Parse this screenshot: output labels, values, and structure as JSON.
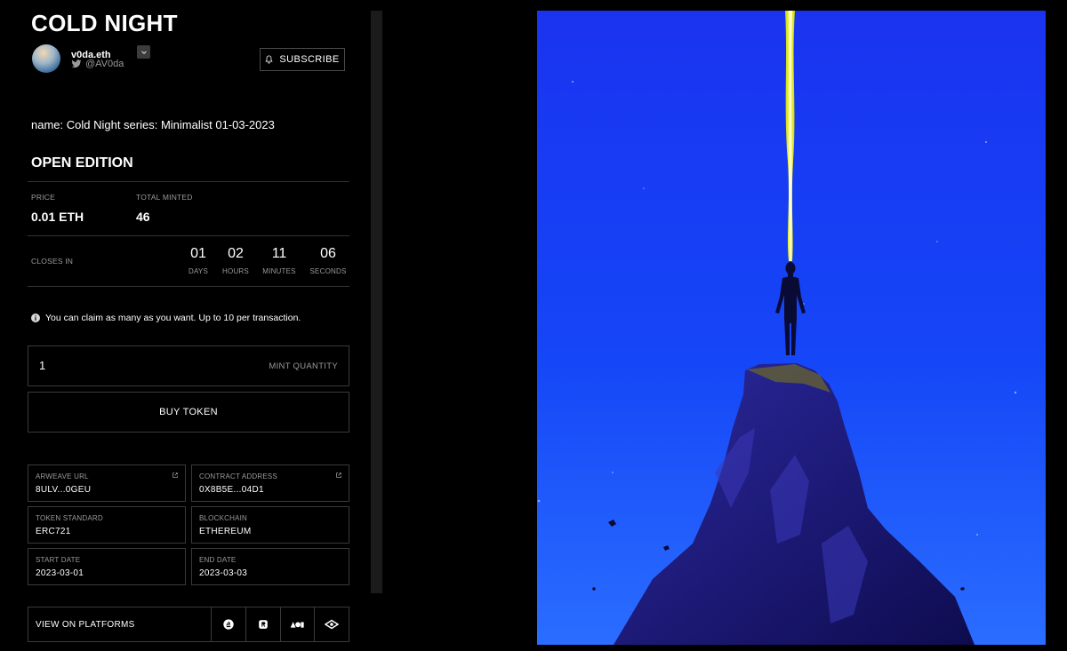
{
  "title": "COLD NIGHT",
  "creator": {
    "name": "v0da.eth",
    "twitter_handle": "@AV0da",
    "subscribe_label": "SUBSCRIBE"
  },
  "name_line": "name: Cold Night series: Minimalist 01-03-2023",
  "edition": {
    "heading": "OPEN EDITION",
    "price_label": "PRICE",
    "price_value": "0.01 ETH",
    "minted_label": "TOTAL MINTED",
    "minted_value": "46",
    "closes_label": "CLOSES IN",
    "countdown": [
      {
        "value": "01",
        "unit": "DAYS"
      },
      {
        "value": "02",
        "unit": "HOURS"
      },
      {
        "value": "11",
        "unit": "MINUTES"
      },
      {
        "value": "06",
        "unit": "SECONDS"
      }
    ]
  },
  "claim_info": "You can claim as many as you want. Up to 10 per transaction.",
  "mint": {
    "quantity_value": "1",
    "quantity_label": "MINT QUANTITY",
    "buy_label": "BUY TOKEN"
  },
  "details": {
    "arweave": {
      "label": "ARWEAVE URL",
      "value": "8ULV...0GEU"
    },
    "contract": {
      "label": "CONTRACT ADDRESS",
      "value": "0X8B5E...04D1"
    },
    "standard": {
      "label": "TOKEN STANDARD",
      "value": "ERC721"
    },
    "chain": {
      "label": "BLOCKCHAIN",
      "value": "ETHEREUM"
    },
    "start": {
      "label": "START DATE",
      "value": "2023-03-01"
    },
    "end": {
      "label": "END DATE",
      "value": "2023-03-03"
    }
  },
  "platforms": {
    "label": "VIEW ON PLATFORMS",
    "icons": [
      "opensea-icon",
      "rarible-icon",
      "foundation-icon",
      "eye-icon"
    ]
  },
  "colors": {
    "background": "#000000",
    "border": "#3a3a3a",
    "muted_text": "#9a9a9a",
    "art_sky": "#1a3cf0",
    "art_beam": "#f4ff3a"
  }
}
